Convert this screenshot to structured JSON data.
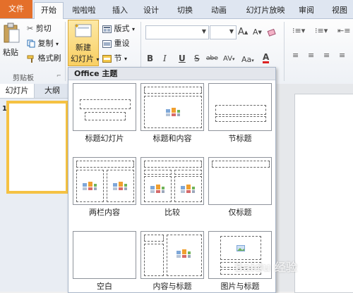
{
  "tabs": {
    "file": "文件",
    "home": "开始",
    "custom": "啦啦啦",
    "insert": "插入",
    "design": "设计",
    "transitions": "切换",
    "animations": "动画",
    "slideshow": "幻灯片放映",
    "review": "审阅",
    "view": "视图"
  },
  "clipboard": {
    "paste": "粘贴",
    "cut": "剪切",
    "copy": "复制",
    "copy_arrow": "▾",
    "format_painter": "格式刷",
    "group_label": "剪贴板"
  },
  "slides": {
    "new_slide_line1": "新建",
    "new_slide_line2": "幻灯片",
    "new_slide_arrow": "▾",
    "layout": "版式",
    "layout_arrow": "▾",
    "reset": "重设",
    "section": "节",
    "section_arrow": "▾"
  },
  "font": {
    "bold": "B",
    "italic": "I",
    "underline": "U",
    "strike": "S",
    "strike_suffix": "abe",
    "spacing": "AV",
    "change_case": "Aa",
    "color": "A",
    "grow": "A",
    "shrink": "A"
  },
  "left_pane": {
    "tab_slides": "幻灯片",
    "tab_outline": "大纲",
    "slide_number": "1"
  },
  "gallery": {
    "header": "Office 主题",
    "layouts": [
      "标题幻灯片",
      "标题和内容",
      "节标题",
      "两栏内容",
      "比较",
      "仅标题",
      "空白",
      "内容与标题",
      "图片与标题"
    ]
  },
  "watermark": "Baidu 经验",
  "colors": {
    "file_tab": "#e46f2a",
    "new_slide_highlight": "#fbd77a",
    "selected_thumb": "#f5c243"
  }
}
